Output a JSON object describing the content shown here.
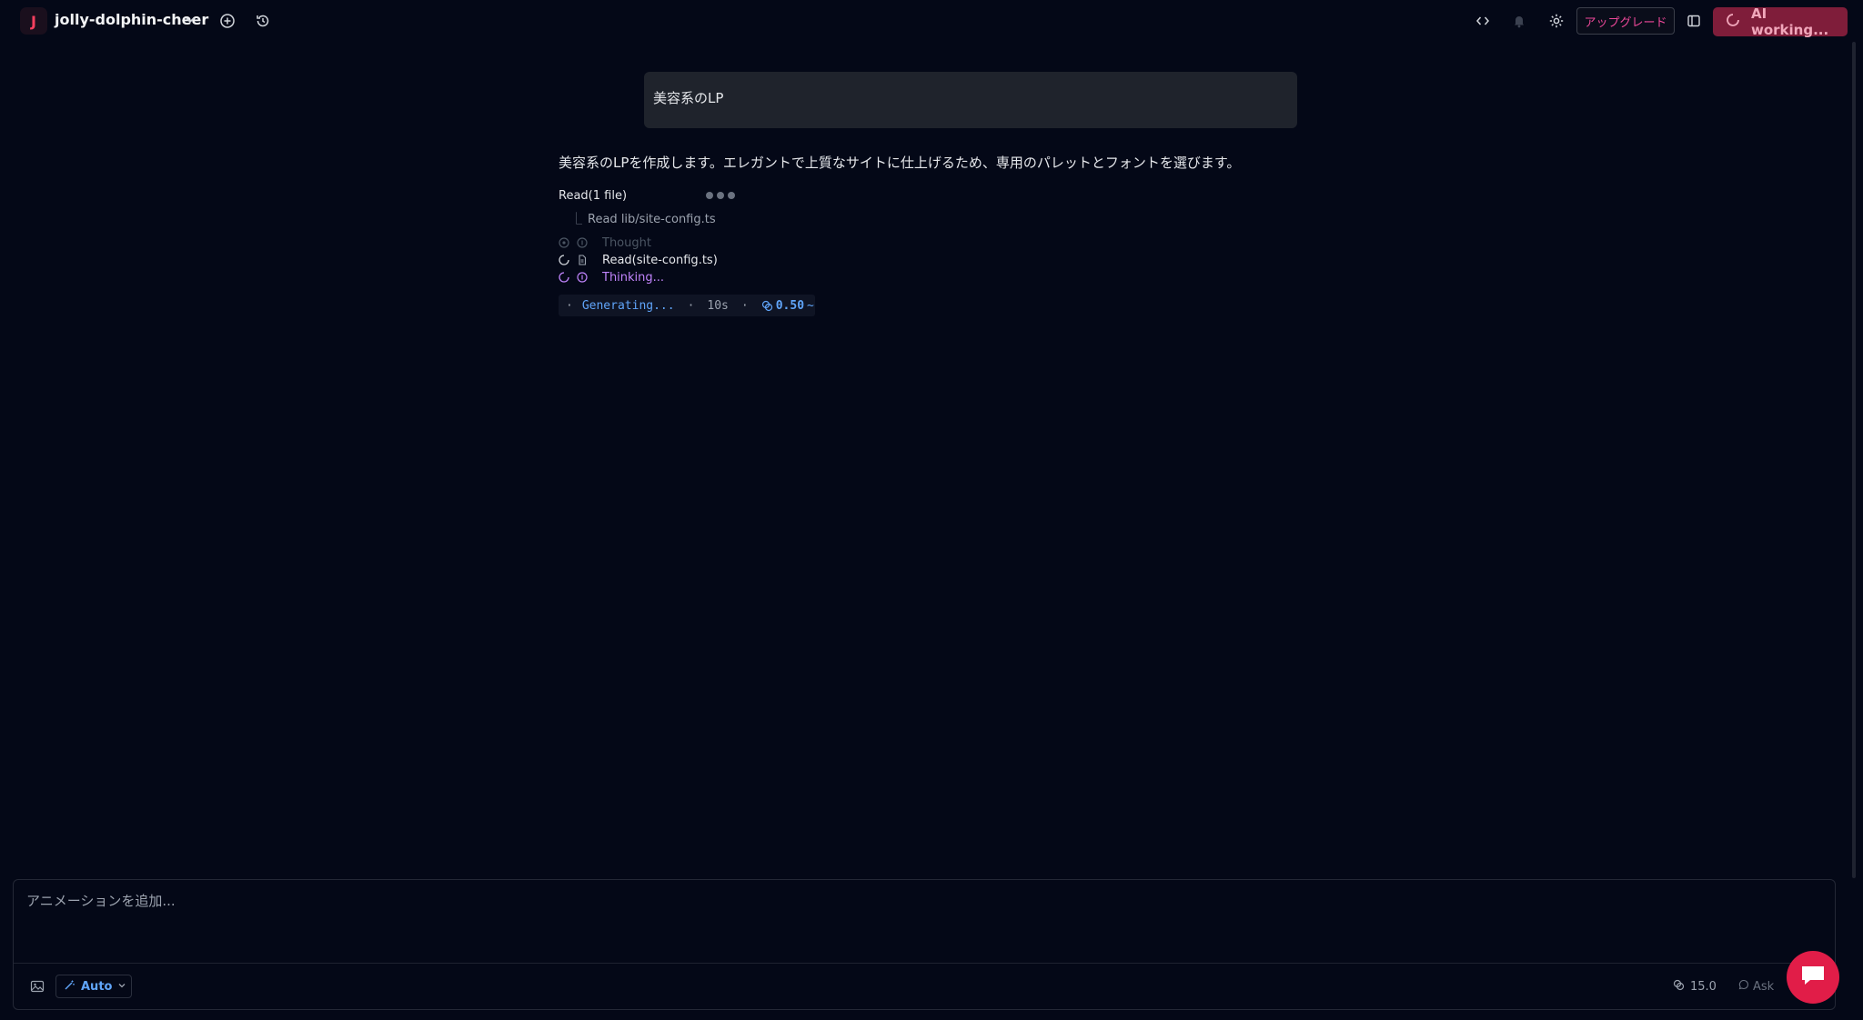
{
  "header": {
    "avatar_letter": "J",
    "project_name": "jolly-dolphin-cheer",
    "upgrade_label": "アップグレード",
    "ai_status_label": "AI working..."
  },
  "chat": {
    "user_message": "美容系のLP",
    "assistant_message": "美容系のLPを作成します。エレガントで上質なサイトに仕上げるため、専用のパレットとフォントを選びます。",
    "read_group": {
      "title": "Read(1 file)",
      "item": "Read lib/site-config.ts"
    },
    "steps": [
      {
        "label": "Thought",
        "state": "done"
      },
      {
        "label": "Read(site-config.ts)",
        "state": "running"
      },
      {
        "label": "Thinking...",
        "state": "active"
      }
    ],
    "status_bar": {
      "sep1": "·",
      "generating": "Generating...",
      "sep2": "·",
      "elapsed": "10s",
      "sep3": "·",
      "cost": "0.50",
      "tilde": "~"
    }
  },
  "composer": {
    "placeholder": "アニメーションを追加...",
    "model_label": "Auto",
    "credits": "15.0",
    "mode_label": "Ask"
  },
  "colors": {
    "background": "#040817",
    "accent_pink": "#e11d48",
    "accent_blue": "#60a5fa",
    "thinking_purple": "#c084fc"
  }
}
